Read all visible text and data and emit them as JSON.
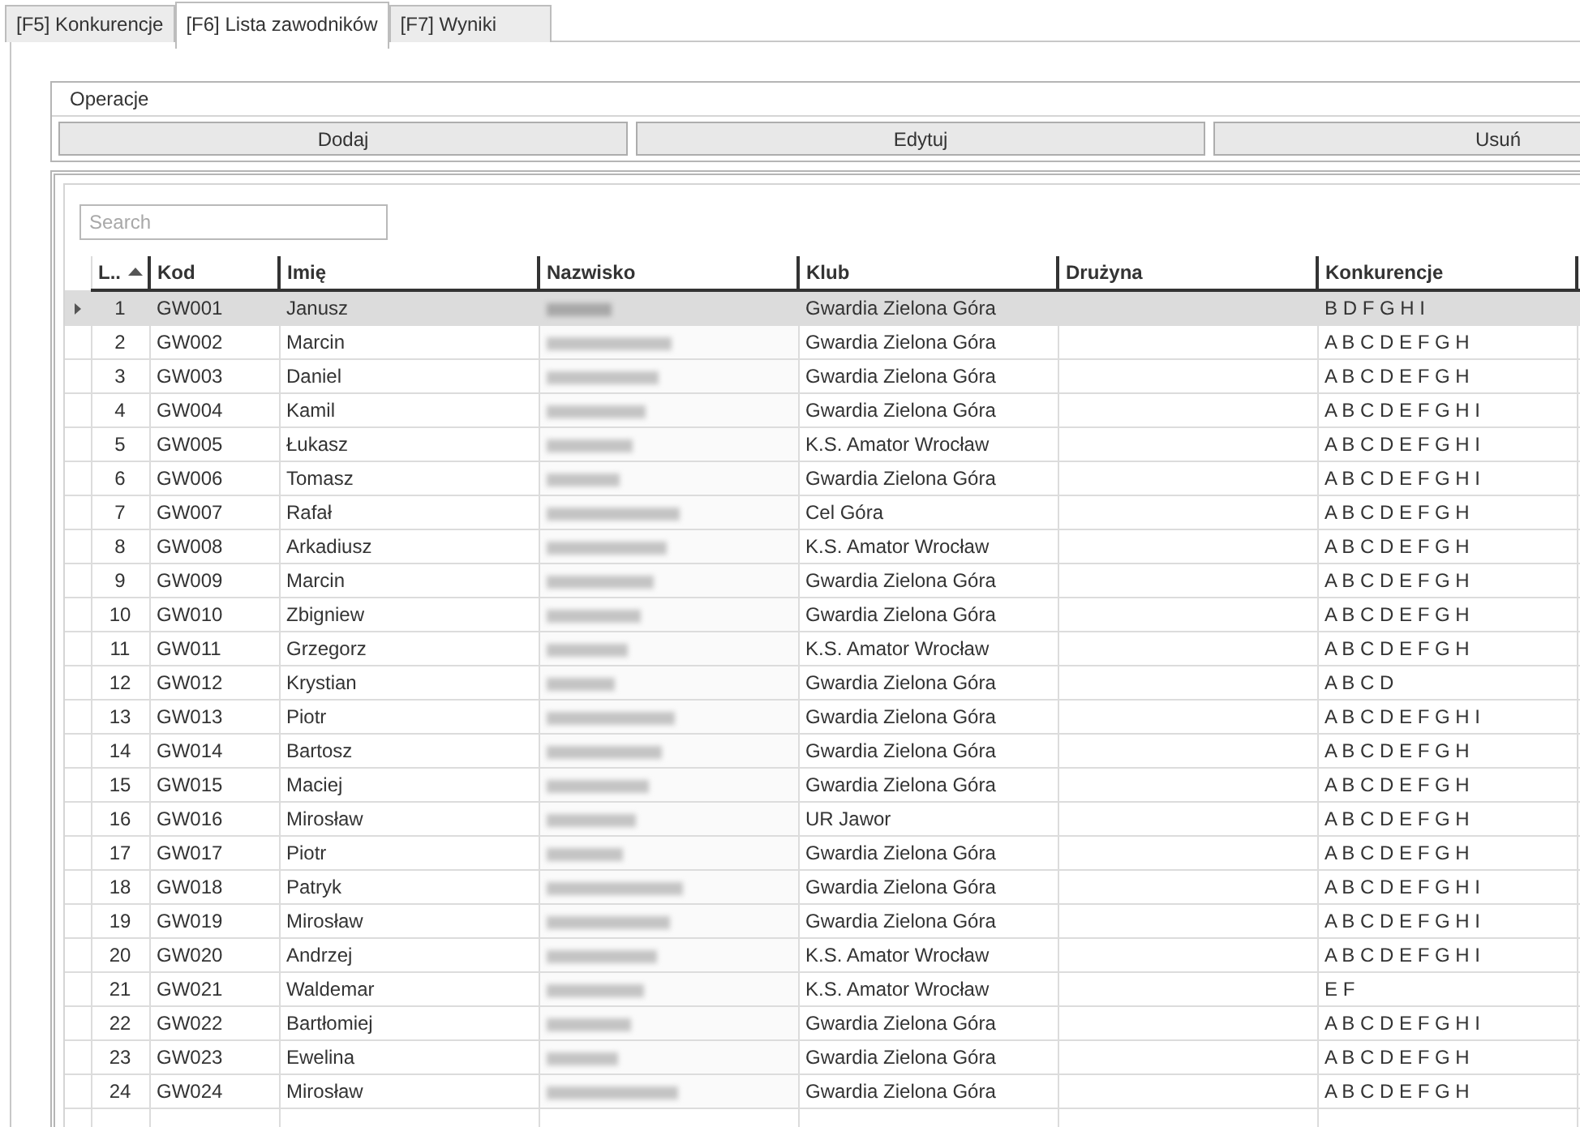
{
  "tabs": [
    {
      "label": "[F5] Konkurencje",
      "selected": false
    },
    {
      "label": "[F6] Lista zawodników",
      "selected": true
    },
    {
      "label": "[F7] Wyniki",
      "selected": false
    }
  ],
  "operations": {
    "title": "Operacje",
    "buttons": [
      "Dodaj",
      "Edytuj",
      "Usuń"
    ]
  },
  "search": {
    "placeholder": "Search"
  },
  "table": {
    "columns": [
      {
        "label": "L..",
        "kind": "number",
        "sorted": true
      },
      {
        "label": "Kod",
        "kind": "text",
        "sorted": false
      },
      {
        "label": "Imię",
        "kind": "text",
        "sorted": false
      },
      {
        "label": "Nazwisko",
        "kind": "redacted",
        "sorted": false
      },
      {
        "label": "Klub",
        "kind": "text",
        "sorted": false
      },
      {
        "label": "Drużyna",
        "kind": "text",
        "sorted": false
      },
      {
        "label": "Konkurencje",
        "kind": "text",
        "sorted": false
      }
    ],
    "rows": [
      {
        "selected": true,
        "cells": [
          "1",
          "GW001",
          "Janusz",
          "",
          "Gwardia Zielona Góra",
          "",
          "B D F G H I"
        ]
      },
      {
        "selected": false,
        "cells": [
          "2",
          "GW002",
          "Marcin",
          "",
          "Gwardia Zielona Góra",
          "",
          "A B C D E F G H"
        ]
      },
      {
        "selected": false,
        "cells": [
          "3",
          "GW003",
          "Daniel",
          "",
          "Gwardia Zielona Góra",
          "",
          "A B C D E F G H"
        ]
      },
      {
        "selected": false,
        "cells": [
          "4",
          "GW004",
          "Kamil",
          "",
          "Gwardia Zielona Góra",
          "",
          "A B C D E F G H I"
        ]
      },
      {
        "selected": false,
        "cells": [
          "5",
          "GW005",
          "Łukasz",
          "",
          "K.S. Amator Wrocław",
          "",
          "A B C D E F G H I"
        ]
      },
      {
        "selected": false,
        "cells": [
          "6",
          "GW006",
          "Tomasz",
          "",
          "Gwardia Zielona Góra",
          "",
          "A B C D E F G H I"
        ]
      },
      {
        "selected": false,
        "cells": [
          "7",
          "GW007",
          "Rafał",
          "",
          "Cel Góra",
          "",
          "A B C D E F G H"
        ]
      },
      {
        "selected": false,
        "cells": [
          "8",
          "GW008",
          "Arkadiusz",
          "",
          "K.S. Amator Wrocław",
          "",
          "A B C D E F G H"
        ]
      },
      {
        "selected": false,
        "cells": [
          "9",
          "GW009",
          "Marcin",
          "",
          "Gwardia Zielona Góra",
          "",
          "A B C D E F G H"
        ]
      },
      {
        "selected": false,
        "cells": [
          "10",
          "GW010",
          "Zbigniew",
          "",
          "Gwardia Zielona Góra",
          "",
          "A B C D E F G H"
        ]
      },
      {
        "selected": false,
        "cells": [
          "11",
          "GW011",
          "Grzegorz",
          "",
          "K.S. Amator Wrocław",
          "",
          "A B C D E F G H"
        ]
      },
      {
        "selected": false,
        "cells": [
          "12",
          "GW012",
          "Krystian",
          "",
          "Gwardia Zielona Góra",
          "",
          "A B C D"
        ]
      },
      {
        "selected": false,
        "cells": [
          "13",
          "GW013",
          "Piotr",
          "",
          "Gwardia Zielona Góra",
          "",
          "A B C D E F G H I"
        ]
      },
      {
        "selected": false,
        "cells": [
          "14",
          "GW014",
          "Bartosz",
          "",
          "Gwardia Zielona Góra",
          "",
          "A B C D E F G H"
        ]
      },
      {
        "selected": false,
        "cells": [
          "15",
          "GW015",
          "Maciej",
          "",
          "Gwardia Zielona Góra",
          "",
          "A B C D E F G H"
        ]
      },
      {
        "selected": false,
        "cells": [
          "16",
          "GW016",
          "Mirosław",
          "",
          "UR Jawor",
          "",
          "A B C D E F G H"
        ]
      },
      {
        "selected": false,
        "cells": [
          "17",
          "GW017",
          "Piotr",
          "",
          "Gwardia Zielona Góra",
          "",
          "A B C D E F G H"
        ]
      },
      {
        "selected": false,
        "cells": [
          "18",
          "GW018",
          "Patryk",
          "",
          "Gwardia Zielona Góra",
          "",
          "A B C D E F G H I"
        ]
      },
      {
        "selected": false,
        "cells": [
          "19",
          "GW019",
          "Mirosław",
          "",
          "Gwardia Zielona Góra",
          "",
          "A B C D E F G H I"
        ]
      },
      {
        "selected": false,
        "cells": [
          "20",
          "GW020",
          "Andrzej",
          "",
          "K.S. Amator Wrocław",
          "",
          "A B C D E F G H I"
        ]
      },
      {
        "selected": false,
        "cells": [
          "21",
          "GW021",
          "Waldemar",
          "",
          "K.S. Amator Wrocław",
          "",
          "E F"
        ]
      },
      {
        "selected": false,
        "cells": [
          "22",
          "GW022",
          "Bartłomiej",
          "",
          "Gwardia Zielona Góra",
          "",
          "A B C D E F G H I"
        ]
      },
      {
        "selected": false,
        "cells": [
          "23",
          "GW023",
          "Ewelina",
          "",
          "Gwardia Zielona Góra",
          "",
          "A B C D E F G H"
        ]
      },
      {
        "selected": false,
        "cells": [
          "24",
          "GW024",
          "Mirosław",
          "",
          "Gwardia Zielona Góra",
          "",
          "A B C D E F G H"
        ]
      }
    ]
  }
}
